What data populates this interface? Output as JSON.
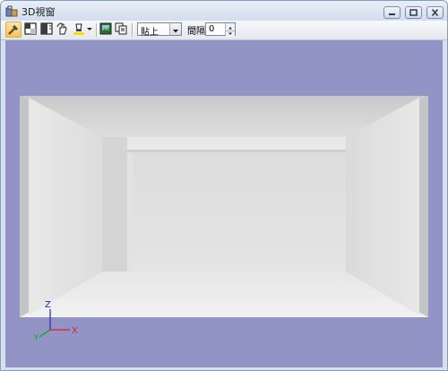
{
  "window": {
    "title": "3D視窗"
  },
  "toolbar": {
    "buttons": [
      {
        "icon": "pick-tool-icon"
      },
      {
        "icon": "view-tile-icon"
      },
      {
        "icon": "view-single-icon"
      },
      {
        "icon": "rotate-hand-icon"
      },
      {
        "icon": "light-bulb-icon"
      },
      {
        "icon": "render-image-icon"
      },
      {
        "icon": "copy-view-icon"
      }
    ],
    "mode_select": {
      "value": "貼上"
    },
    "spacing": {
      "label": "間隔",
      "value": "0"
    }
  },
  "viewport": {
    "background": "#9394c6",
    "axes": {
      "x_label": "X",
      "y_label": "Y",
      "z_label": "Z",
      "x_color": "#e02020",
      "y_color": "#10a010",
      "z_color": "#2020c8"
    }
  }
}
